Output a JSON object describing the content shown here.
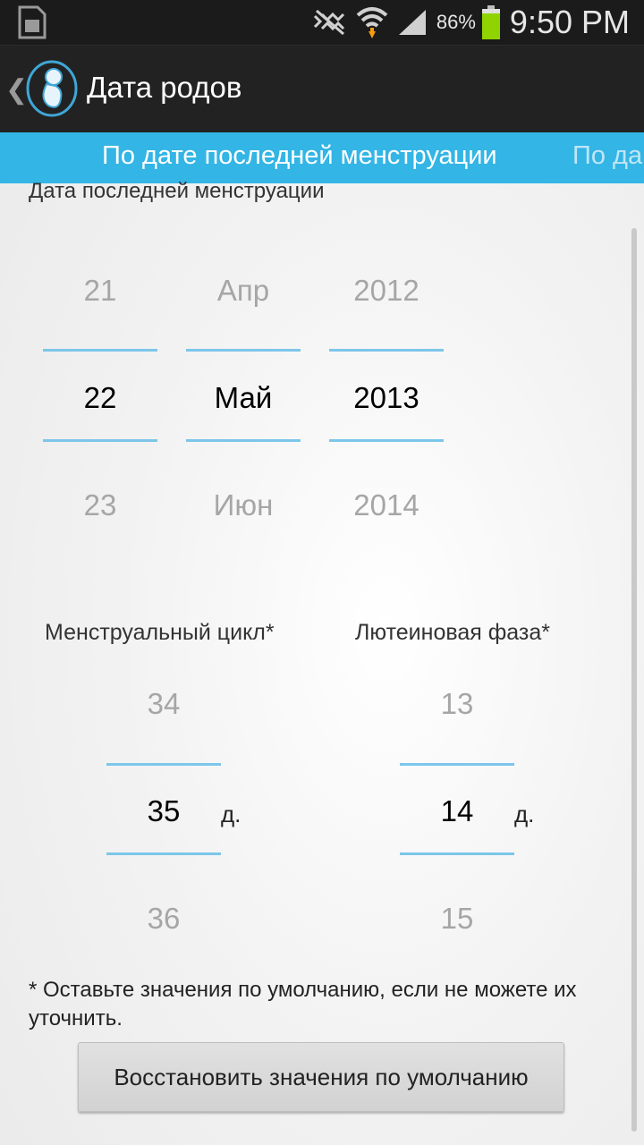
{
  "status_bar": {
    "battery_percent": "86%",
    "time": "9:50 PM",
    "icons": [
      "sim-card-icon",
      "mute-icon",
      "wifi-icon",
      "signal-icon",
      "battery-icon"
    ]
  },
  "action_bar": {
    "title": "Дата родов",
    "icon": "fetus-logo-icon"
  },
  "tabs": {
    "active": "По дате последней менструации",
    "next": "По да"
  },
  "section_title": "Дата последней менструации",
  "date_picker": {
    "day": {
      "prev": "21",
      "selected": "22",
      "next": "23"
    },
    "month": {
      "prev": "Апр",
      "selected": "Май",
      "next": "Июн"
    },
    "year": {
      "prev": "2012",
      "selected": "2013",
      "next": "2014"
    }
  },
  "cycle": {
    "label": "Менструальный цикл*",
    "prev": "34",
    "selected": "35",
    "next": "36",
    "unit": "д."
  },
  "luteal": {
    "label": "Лютеиновая фаза*",
    "prev": "13",
    "selected": "14",
    "next": "15",
    "unit": "д."
  },
  "note": "* Оставьте значения по умолчанию, если не можете их уточнить.",
  "reset_button": "Восстановить значения по умолчанию",
  "colors": {
    "accent": "#33b5e5",
    "picker_line": "#7cc6ea",
    "action_bar": "#222222"
  }
}
